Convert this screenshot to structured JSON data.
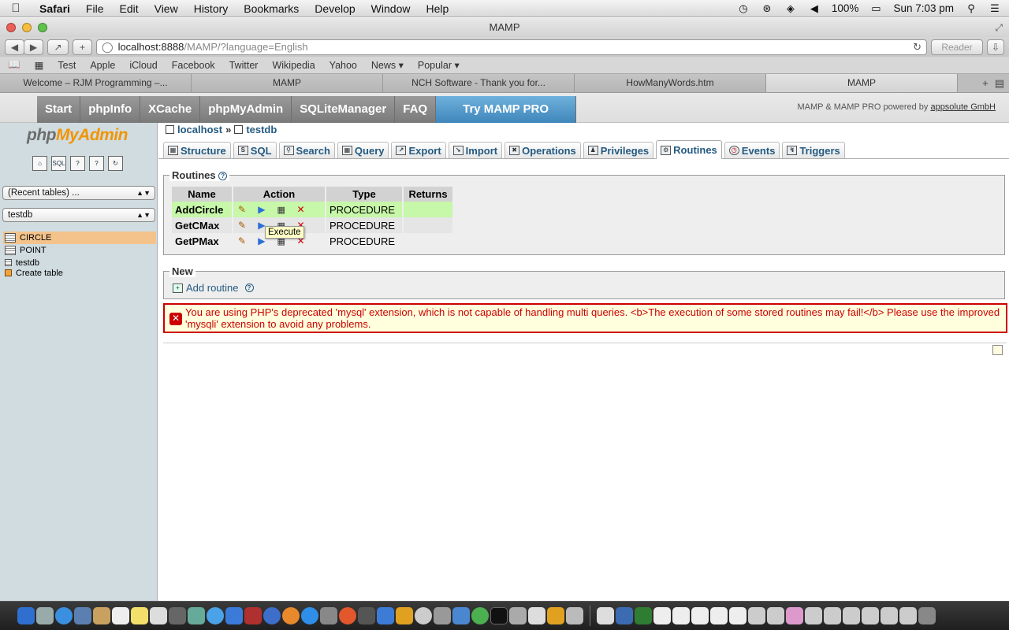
{
  "menubar": {
    "app_name": "Safari",
    "items": [
      "File",
      "Edit",
      "View",
      "History",
      "Bookmarks",
      "Develop",
      "Window",
      "Help"
    ],
    "battery": "100%",
    "clock": "Sun 7:03 pm"
  },
  "window": {
    "title": "MAMP"
  },
  "toolbar": {
    "url_host": "localhost:8888",
    "url_path": "/MAMP/?language=English",
    "reader_label": "Reader"
  },
  "bookmarks": [
    "Test",
    "Apple",
    "iCloud",
    "Facebook",
    "Twitter",
    "Wikipedia",
    "Yahoo",
    "News ▾",
    "Popular ▾"
  ],
  "browser_tabs": [
    {
      "label": "Welcome – RJM Programming –..."
    },
    {
      "label": "MAMP"
    },
    {
      "label": "NCH Software - Thank you for..."
    },
    {
      "label": "HowManyWords.htm"
    },
    {
      "label": "MAMP"
    }
  ],
  "mamp_nav": {
    "items": [
      "Start",
      "phpInfo",
      "XCache",
      "phpMyAdmin",
      "SQLiteManager",
      "FAQ"
    ],
    "pro": "Try MAMP PRO",
    "credit_prefix": "MAMP & MAMP PRO powered by ",
    "credit_link": "appsolute GmbH"
  },
  "sidebar": {
    "logo_php": "php",
    "logo_myadmin": "MyAdmin",
    "recent_tables": "(Recent tables) ...",
    "database": "testdb",
    "tables": [
      "CIRCLE",
      "POINT"
    ],
    "db_link": "testdb",
    "create_table": "Create table"
  },
  "breadcrumb": {
    "server": "localhost",
    "sep": "»",
    "db": "testdb"
  },
  "pma_tabs": [
    "Structure",
    "SQL",
    "Search",
    "Query",
    "Export",
    "Import",
    "Operations",
    "Privileges",
    "Routines",
    "Events",
    "Triggers"
  ],
  "routines": {
    "legend": "Routines",
    "help": "?",
    "headers": {
      "name": "Name",
      "action": "Action",
      "type": "Type",
      "returns": "Returns"
    },
    "rows": [
      {
        "name": "AddCircle",
        "type": "PROCEDURE",
        "returns": ""
      },
      {
        "name": "GetCMax",
        "type": "PROCEDURE",
        "returns": ""
      },
      {
        "name": "GetPMax",
        "type": "PROCEDURE",
        "returns": ""
      }
    ],
    "tooltip": "Execute"
  },
  "new_section": {
    "legend": "New",
    "add_routine": "Add routine",
    "help": "?"
  },
  "error_message": "You are using PHP's deprecated 'mysql' extension, which is not capable of handling multi queries. <b>The execution of some stored routines may fail!</b> Please use the improved 'mysqli' extension to avoid any problems."
}
